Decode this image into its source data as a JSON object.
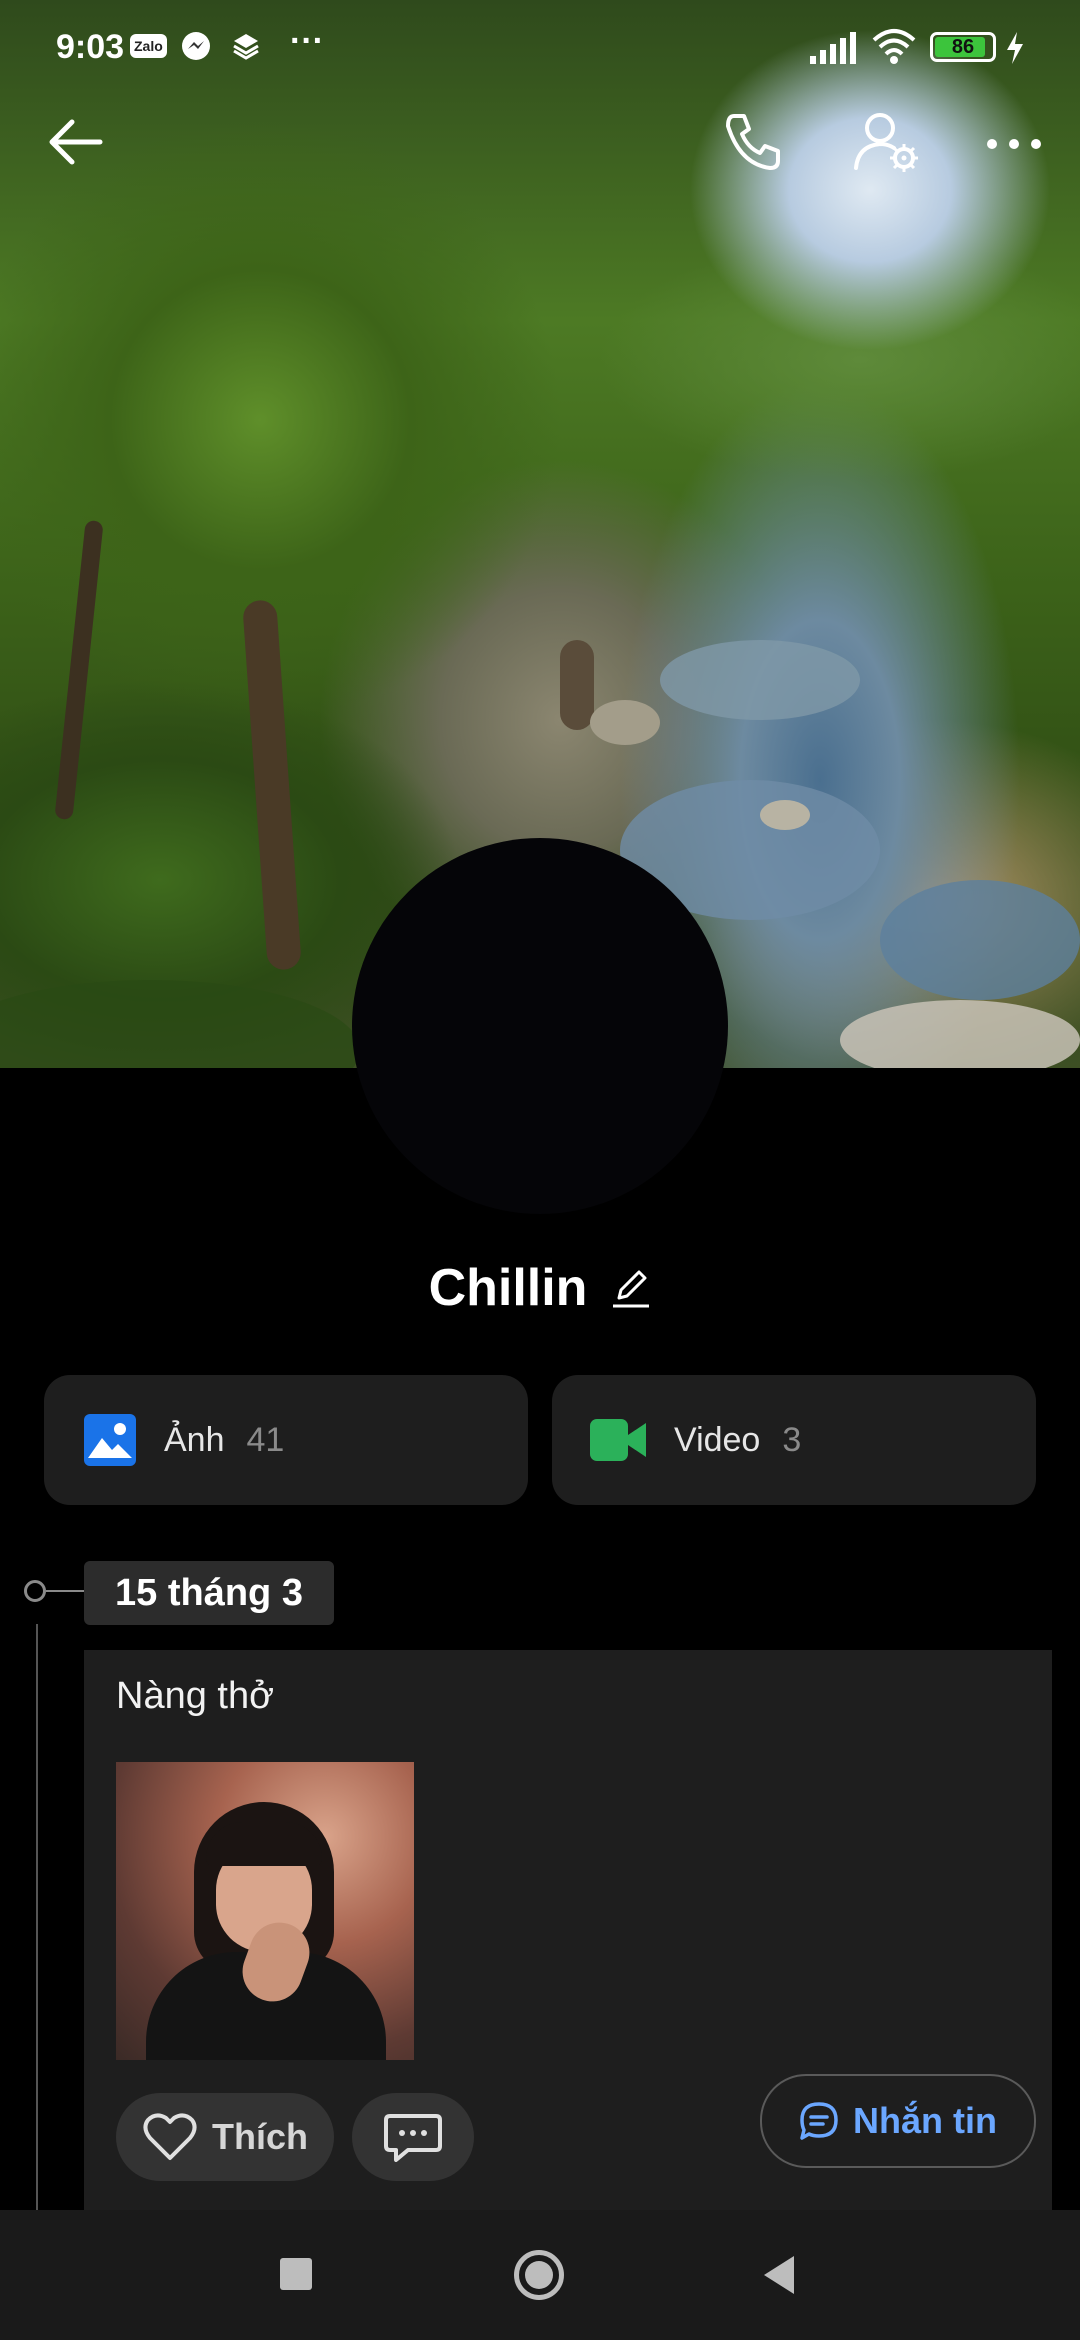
{
  "status_bar": {
    "time": "9:03",
    "app_chip": "Zalo",
    "more": "···",
    "battery": "86"
  },
  "header": {
    "back_icon": "arrow-left-icon",
    "call_icon": "phone-icon",
    "settings_icon": "user-settings-icon",
    "more_icon": "more-horizontal-icon"
  },
  "profile": {
    "name": "Chillin",
    "edit_icon": "pencil-icon"
  },
  "media": [
    {
      "label": "Ảnh",
      "count": "41",
      "icon": "photo-icon",
      "color": "#1a73e8"
    },
    {
      "label": "Video",
      "count": "3",
      "icon": "video-camera-icon",
      "color": "#2bb15a"
    }
  ],
  "timeline": {
    "date": "15 tháng 3",
    "post": {
      "text": "Nàng thở",
      "like_label": "Thích",
      "comment_icon": "comment-icon",
      "message_label": "Nhắn tin"
    }
  },
  "colors": {
    "accent_blue": "#6ba7ff",
    "card_bg": "#1e1e1e",
    "page_bg": "#000000"
  }
}
